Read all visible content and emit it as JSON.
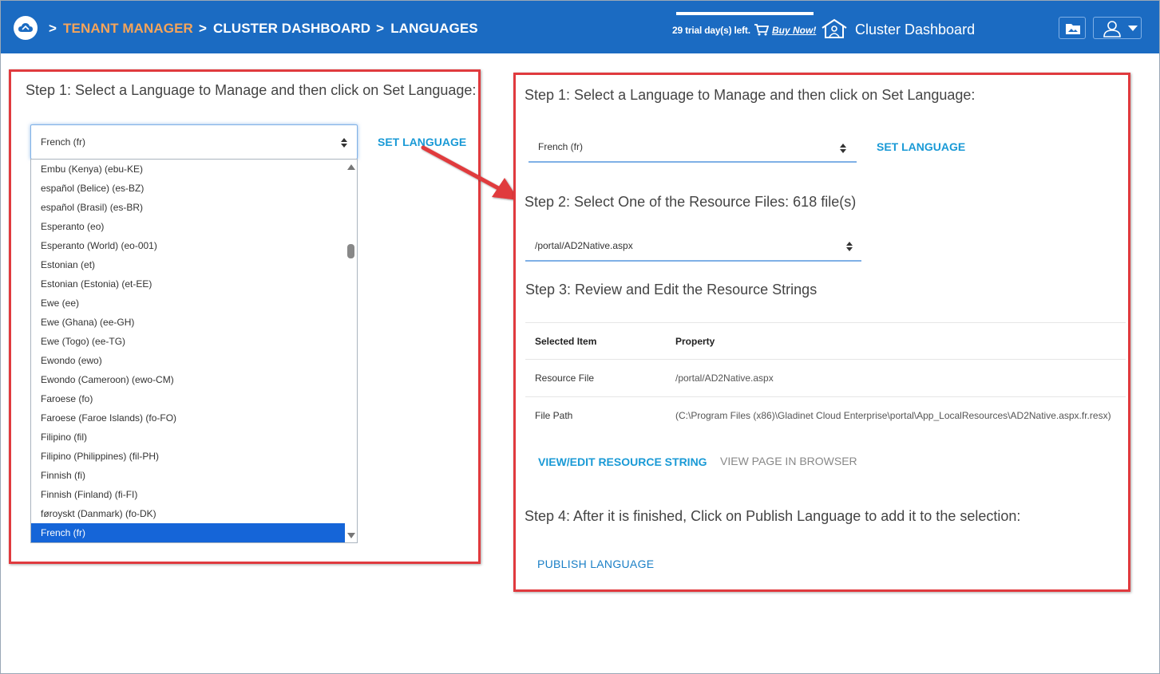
{
  "header": {
    "breadcrumb_sep": ">",
    "breadcrumbs": [
      "TENANT MANAGER",
      "CLUSTER DASHBOARD",
      "LANGUAGES"
    ],
    "trial_text": "29 trial day(s) left.",
    "buy_now": "Buy Now!",
    "page_title": "Cluster Dashboard",
    "colors": {
      "bar": "#1b6bc2",
      "tenant_link": "#f5a45a"
    },
    "icons": [
      "cloud-logo-icon",
      "cart-icon",
      "house-icon",
      "folder-icon",
      "user-icon",
      "caret-down-icon"
    ]
  },
  "left": {
    "step1": "Step 1: Select a Language to Manage and then click on Set Language:",
    "select_value": "French (fr)",
    "set_language": "SET LANGUAGE",
    "options": [
      "Embu (Kenya) (ebu-KE)",
      "español (Belice) (es-BZ)",
      "español (Brasil) (es-BR)",
      "Esperanto (eo)",
      "Esperanto (World) (eo-001)",
      "Estonian (et)",
      "Estonian (Estonia) (et-EE)",
      "Ewe (ee)",
      "Ewe (Ghana) (ee-GH)",
      "Ewe (Togo) (ee-TG)",
      "Ewondo (ewo)",
      "Ewondo (Cameroon) (ewo-CM)",
      "Faroese (fo)",
      "Faroese (Faroe Islands) (fo-FO)",
      "Filipino (fil)",
      "Filipino (Philippines) (fil-PH)",
      "Finnish (fi)",
      "Finnish (Finland) (fi-FI)",
      "føroyskt (Danmark) (fo-DK)",
      "French (fr)"
    ],
    "selected_option": "French (fr)"
  },
  "right": {
    "step1": "Step 1: Select a Language to Manage and then click on Set Language:",
    "language_value": "French (fr)",
    "set_language": "SET LANGUAGE",
    "step2": "Step 2: Select One of the Resource Files: 618 file(s)",
    "resource_file_value": "/portal/AD2Native.aspx",
    "step3": "Step 3: Review and Edit the Resource Strings",
    "table": {
      "headers": [
        "Selected Item",
        "Property"
      ],
      "rows": [
        [
          "Resource File",
          "/portal/AD2Native.aspx"
        ],
        [
          "File Path",
          "(C:\\Program Files (x86)\\Gladinet Cloud Enterprise\\portal\\App_LocalResources\\AD2Native.aspx.fr.resx)"
        ]
      ]
    },
    "view_edit": "VIEW/EDIT RESOURCE STRING",
    "view_page": "VIEW PAGE IN BROWSER",
    "step4": "Step 4: After it is finished, Click on Publish Language to add it to the selection:",
    "publish": "PUBLISH LANGUAGE"
  },
  "annotation_color": "#e03a3e"
}
